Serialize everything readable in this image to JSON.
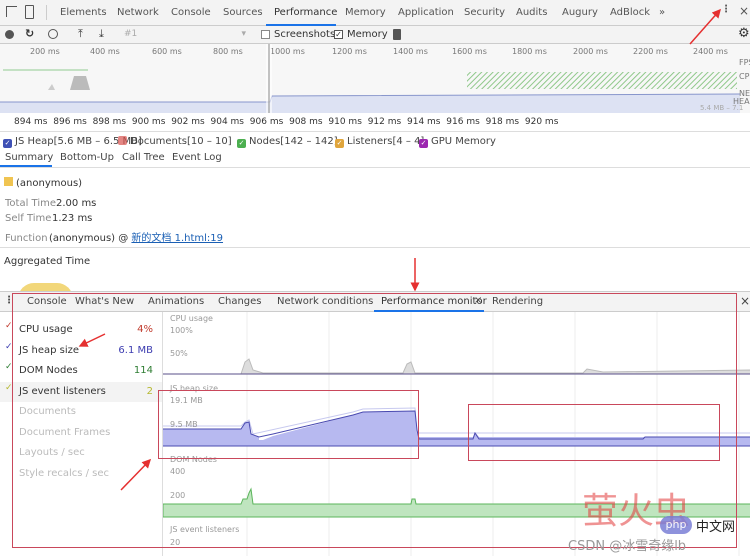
{
  "devtools": {
    "tabs": [
      "Elements",
      "Network",
      "Console",
      "Sources",
      "Performance",
      "Memory",
      "Application",
      "Security",
      "Audits",
      "Augury",
      "AdBlock"
    ],
    "more_tabs": "»",
    "active_tab": "Performance",
    "toolbar": {
      "profile_select": "#1",
      "screenshots_label": "Screenshots",
      "screenshots_checked": false,
      "memory_label": "Memory",
      "memory_checked": true
    },
    "overview": {
      "ticks": [
        "200 ms",
        "400 ms",
        "600 ms",
        "800 ms",
        "1000 ms",
        "1200 ms",
        "1400 ms",
        "1600 ms",
        "1800 ms",
        "2000 ms",
        "2200 ms",
        "2400 ms"
      ],
      "track_labels": [
        "FPS",
        "CPU",
        "NET",
        "HEAP"
      ],
      "heap_range": "5.4 MB – 7.1 MB"
    },
    "ruler_ticks": [
      "894 ms",
      "896 ms",
      "898 ms",
      "900 ms",
      "902 ms",
      "904 ms",
      "906 ms",
      "908 ms",
      "910 ms",
      "912 ms",
      "914 ms",
      "916 ms",
      "918 ms",
      "920 ms"
    ],
    "legend": [
      {
        "label": "JS Heap[5.6 MB – 6.5 MB]",
        "color": "#3f51b5",
        "checked": true
      },
      {
        "label": "Documents[10 – 10]",
        "color": "#d9534f",
        "checked": false
      },
      {
        "label": "Nodes[142 – 142]",
        "color": "#4caf50",
        "checked": true
      },
      {
        "label": "Listeners[4 – 4]",
        "color": "#e0a53c",
        "checked": true
      },
      {
        "label": "GPU Memory",
        "color": "#9c27b0",
        "checked": true
      }
    ],
    "detail_tabs": [
      "Summary",
      "Bottom-Up",
      "Call Tree",
      "Event Log"
    ],
    "summary": {
      "title": "(anonymous)",
      "swatch_color": "#f0c451",
      "total_time_label": "Total Time",
      "total_time": "2.00 ms",
      "self_time_label": "Self Time",
      "self_time": "1.23 ms",
      "function_label": "Function",
      "function_value": "(anonymous) @ ",
      "function_link": "新的文档 1.html:19",
      "aggregated_label": "Aggregated Time"
    }
  },
  "drawer": {
    "tabs": [
      "Console",
      "What's New",
      "Animations",
      "Changes",
      "Network conditions",
      "Performance monitor",
      "Rendering"
    ],
    "active_tab": "Performance monitor",
    "metrics": [
      {
        "label": "CPU usage",
        "value": "4%",
        "color": "#c0392b",
        "active": true
      },
      {
        "label": "JS heap size",
        "value": "6.1 MB",
        "color": "#3c3cb0",
        "active": true
      },
      {
        "label": "DOM Nodes",
        "value": "114",
        "color": "#2e7d32",
        "active": true
      },
      {
        "label": "JS event listeners",
        "value": "2",
        "color": "#b5b830",
        "active": true
      },
      {
        "label": "Documents",
        "value": "",
        "active": false
      },
      {
        "label": "Document Frames",
        "value": "",
        "active": false
      },
      {
        "label": "Layouts / sec",
        "value": "",
        "active": false
      },
      {
        "label": "Style recalcs / sec",
        "value": "",
        "active": false
      }
    ],
    "charts": {
      "cpu": {
        "title": "CPU usage",
        "ticks": [
          "100%",
          "50%"
        ]
      },
      "heap": {
        "title": "JS heap size",
        "ticks": [
          "19.1 MB",
          "9.5 MB"
        ]
      },
      "dom": {
        "title": "DOM Nodes",
        "ticks": [
          "400",
          "200"
        ]
      },
      "listeners": {
        "title": "JS event listeners",
        "ticks": [
          "20"
        ]
      }
    }
  },
  "watermark": {
    "php": "php",
    "site": "中文网",
    "csdn": "CSDN @冰雪奇缘lb"
  }
}
